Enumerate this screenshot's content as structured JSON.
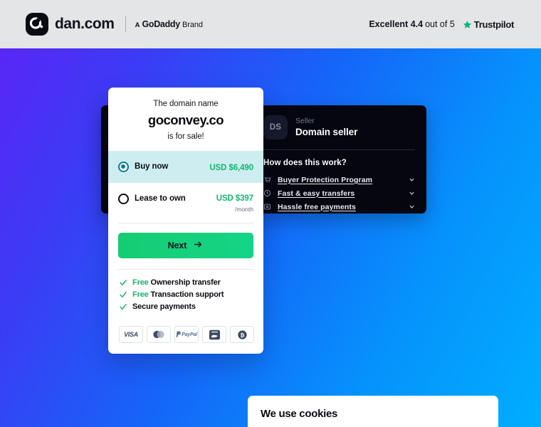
{
  "header": {
    "brand_name": "dan.com",
    "logo_icon": "dan-logo-icon",
    "godaddy_a": "A",
    "godaddy_name": "GoDaddy",
    "godaddy_brand": "Brand",
    "trust_rating_label": "Excellent 4.4",
    "trust_out_of": "out of 5",
    "trust_star_icon": "star-icon",
    "trust_name": "Trustpilot",
    "background_color": "#E4E5E7"
  },
  "seller": {
    "avatar_initials": "DS",
    "label": "Seller",
    "name": "Domain seller",
    "how_title": "How does this work?",
    "items": [
      {
        "label": "Buyer Protection Program",
        "icon": "shield-cart-icon",
        "chevron": "chevron-down-icon"
      },
      {
        "label": "Fast & easy transfers",
        "icon": "clock-icon",
        "chevron": "chevron-down-icon"
      },
      {
        "label": "Hassle free payments",
        "icon": "payment-card-icon",
        "chevron": "chevron-down-icon"
      }
    ],
    "panel_color": "#05060F"
  },
  "buy_card": {
    "domain_pre": "The domain name",
    "domain_name": "goconvey.co",
    "domain_post": "is for sale!",
    "options": [
      {
        "label": "Buy now",
        "price": "USD $6,490",
        "period": "",
        "selected": true,
        "radio_icon": "radio-selected-icon"
      },
      {
        "label": "Lease to own",
        "price": "USD $397",
        "period": "/month",
        "selected": false,
        "radio_icon": "radio-unselected-icon"
      }
    ],
    "next_label": "Next",
    "next_arrow_icon": "arrow-right-icon",
    "benefits": [
      {
        "free": "Free",
        "text": "Ownership transfer",
        "icon": "check-icon"
      },
      {
        "free": "Free",
        "text": "Transaction support",
        "icon": "check-icon"
      },
      {
        "free": "",
        "text": "Secure payments",
        "icon": "check-icon"
      }
    ],
    "payment_methods": [
      {
        "name": "visa-icon",
        "text": "VISA"
      },
      {
        "name": "mastercard-icon",
        "text": ""
      },
      {
        "name": "paypal-icon",
        "text": "PayPal"
      },
      {
        "name": "alipay-icon",
        "text": ""
      },
      {
        "name": "bitcoin-icon",
        "text": ""
      }
    ],
    "accent_green": "#12B76A",
    "selected_row_color": "#CDEDF1"
  },
  "cookie_banner": {
    "title": "We use cookies"
  },
  "background": {
    "gradient_from": "#5E23F5",
    "gradient_to": "#00AEFF"
  }
}
